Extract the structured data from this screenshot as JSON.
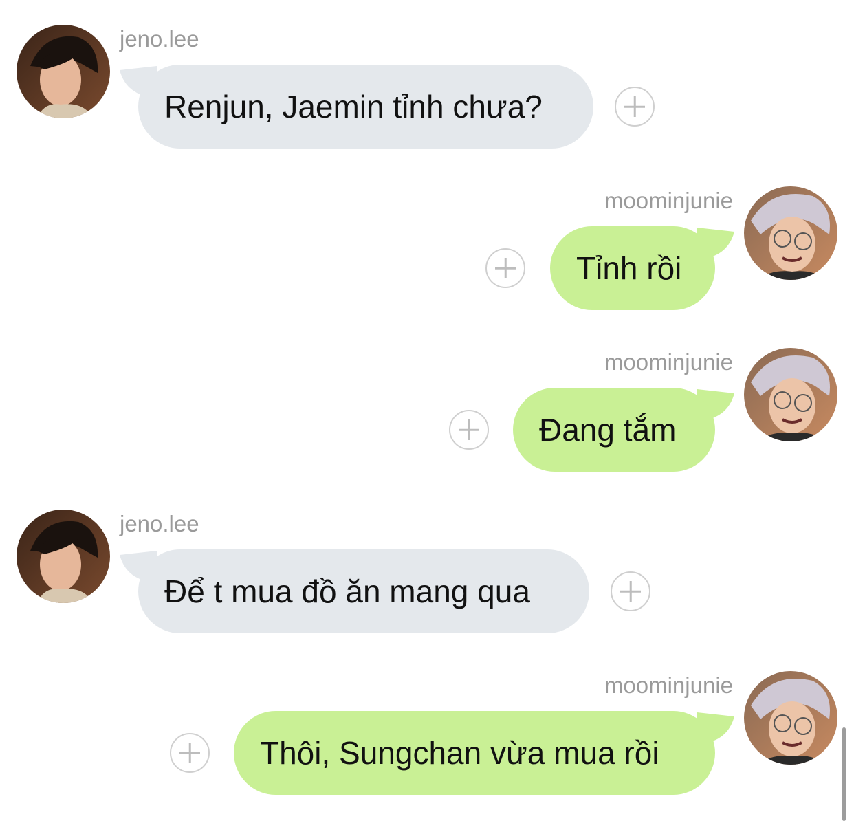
{
  "messages": [
    {
      "sender": "jeno.lee",
      "side": "left",
      "text": "Renjun, Jaemin tỉnh chưa?"
    },
    {
      "sender": "moominjunie",
      "side": "right",
      "text": "Tỉnh rồi"
    },
    {
      "sender": "moominjunie",
      "side": "right",
      "text": "Đang tắm"
    },
    {
      "sender": "jeno.lee",
      "side": "left",
      "text": "Để t mua đồ ăn mang qua"
    },
    {
      "sender": "moominjunie",
      "side": "right",
      "text": "Thôi, Sungchan vừa mua rồi"
    }
  ],
  "colors": {
    "incoming_bubble": "#e4e8ec",
    "outgoing_bubble": "#c9f095",
    "username": "#9a9a9a",
    "add_reaction_icon": "#c8c8c8"
  },
  "icons": {
    "add_reaction": "plus-circle-icon",
    "avatar_left": "avatar-photo",
    "avatar_right": "avatar-photo"
  }
}
